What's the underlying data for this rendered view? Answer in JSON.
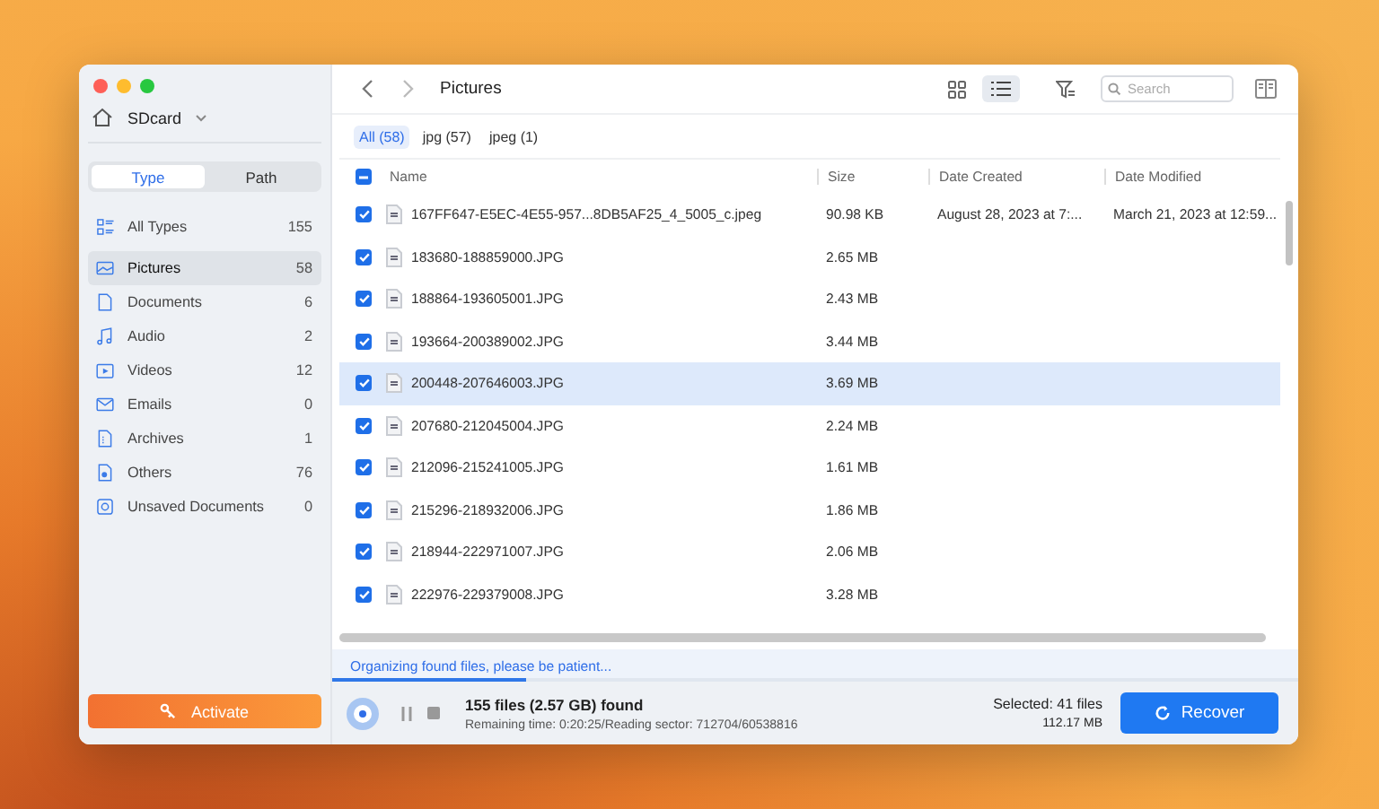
{
  "sidebar": {
    "device": "SDcard",
    "segments": [
      {
        "label": "Type",
        "selected": true
      },
      {
        "label": "Path",
        "selected": false
      }
    ],
    "items": [
      {
        "kind": "all",
        "label": "All Types",
        "count": "155",
        "selected": false
      },
      {
        "kind": "pictures",
        "label": "Pictures",
        "count": "58",
        "selected": true
      },
      {
        "kind": "documents",
        "label": "Documents",
        "count": "6",
        "selected": false
      },
      {
        "kind": "audio",
        "label": "Audio",
        "count": "2",
        "selected": false
      },
      {
        "kind": "videos",
        "label": "Videos",
        "count": "12",
        "selected": false
      },
      {
        "kind": "emails",
        "label": "Emails",
        "count": "0",
        "selected": false
      },
      {
        "kind": "archives",
        "label": "Archives",
        "count": "1",
        "selected": false
      },
      {
        "kind": "others",
        "label": "Others",
        "count": "76",
        "selected": false
      },
      {
        "kind": "unsaved",
        "label": "Unsaved Documents",
        "count": "0",
        "selected": false
      }
    ],
    "activate_button": "Activate"
  },
  "toolbar": {
    "title": "Pictures",
    "views": [
      {
        "kind": "grid",
        "selected": false
      },
      {
        "kind": "list",
        "selected": true
      }
    ],
    "search": {
      "placeholder": "Search"
    }
  },
  "filters": [
    {
      "label": "All (58)",
      "selected": true
    },
    {
      "label": "jpg (57)",
      "selected": false
    },
    {
      "label": "jpeg (1)",
      "selected": false
    }
  ],
  "table": {
    "select_all": {
      "checked": true,
      "mixed": true
    },
    "columns": [
      "Name",
      "Size",
      "Date Created",
      "Date Modified"
    ],
    "rows": [
      {
        "name": "167FF647-E5EC-4E55-957...8DB5AF25_4_5005_c.jpeg",
        "size": "90.98 KB",
        "created": "August 28, 2023 at 7:...",
        "modified": "March 21, 2023 at 12:59...",
        "checked": true,
        "selected": false
      },
      {
        "name": "183680-188859000.JPG",
        "size": "2.65 MB",
        "checked": true,
        "selected": false
      },
      {
        "name": "188864-193605001.JPG",
        "size": "2.43 MB",
        "checked": true,
        "selected": false
      },
      {
        "name": "193664-200389002.JPG",
        "size": "3.44 MB",
        "checked": true,
        "selected": false
      },
      {
        "name": "200448-207646003.JPG",
        "size": "3.69 MB",
        "checked": true,
        "selected": true
      },
      {
        "name": "207680-212045004.JPG",
        "size": "2.24 MB",
        "checked": true,
        "selected": false
      },
      {
        "name": "212096-215241005.JPG",
        "size": "1.61 MB",
        "checked": true,
        "selected": false
      },
      {
        "name": "215296-218932006.JPG",
        "size": "1.86 MB",
        "checked": true,
        "selected": false
      },
      {
        "name": "218944-222971007.JPG",
        "size": "2.06 MB",
        "checked": true,
        "selected": false
      },
      {
        "name": "222976-229379008.JPG",
        "size": "3.28 MB",
        "checked": true,
        "selected": false
      }
    ]
  },
  "status": {
    "message": "Organizing found files, please be patient...",
    "level": 0.2
  },
  "footer": {
    "found": "155 files (2.57 GB) found",
    "remaining": "Remaining time: 0:20:25/Reading sector: 712704/60538816",
    "selected": "Selected: 41 files",
    "selected_size": "112.17 MB",
    "recover_button": "Recover"
  }
}
